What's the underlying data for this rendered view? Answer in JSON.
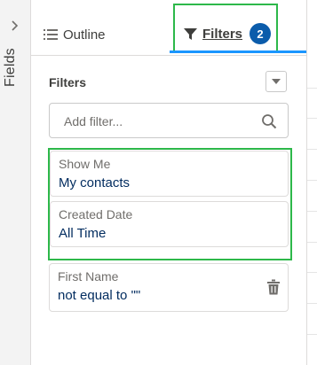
{
  "rail": {
    "label": "Fields"
  },
  "tabs": {
    "outline_label": "Outline",
    "filters_label": "Filters",
    "filters_badge": "2"
  },
  "section": {
    "title": "Filters"
  },
  "search": {
    "placeholder": "Add filter..."
  },
  "filters": [
    {
      "label": "Show Me",
      "value": "My contacts"
    },
    {
      "label": "Created Date",
      "value": "All Time"
    },
    {
      "label": "First Name",
      "value": "not equal to \"\""
    }
  ],
  "colors": {
    "highlight": "#2db84a",
    "active_tab": "#1b96ff",
    "badge": "#0b5cab",
    "value_text": "#032d60"
  },
  "icons": {
    "rail": "chevron-right-icon",
    "outline": "list-icon",
    "filters": "filter-icon",
    "dropdown": "caret-down-icon",
    "search": "search-icon",
    "remove": "trash-icon"
  }
}
